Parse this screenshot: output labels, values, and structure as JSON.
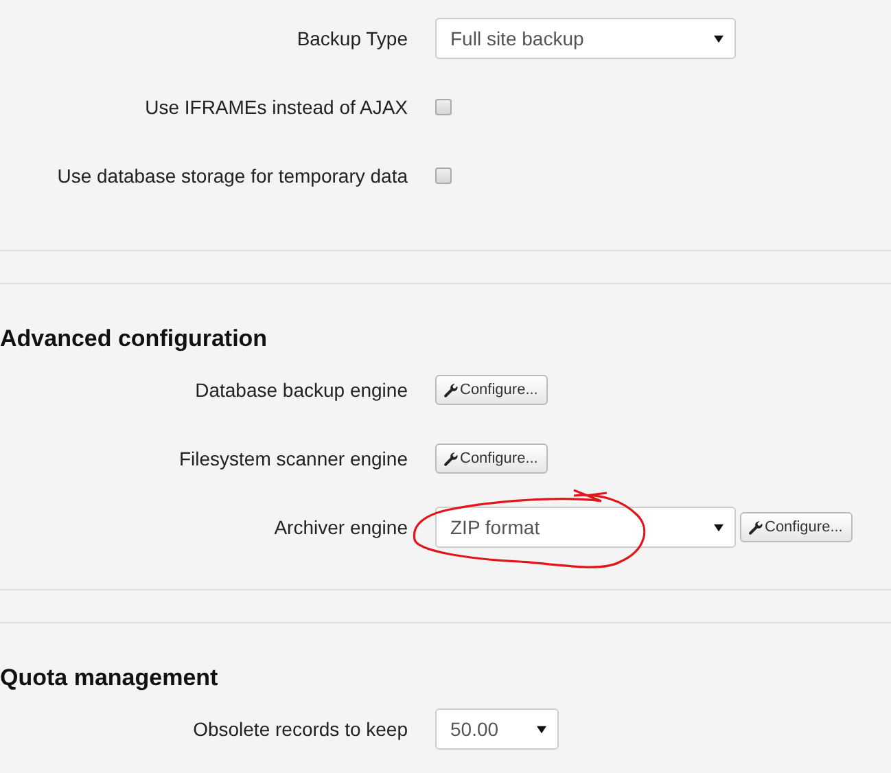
{
  "sections": [
    {
      "rows": [
        {
          "kind": "select",
          "label": "Backup Type",
          "value": "Full site backup"
        },
        {
          "kind": "checkbox",
          "label": "Use IFRAMEs instead of AJAX",
          "checked": false
        },
        {
          "kind": "checkbox",
          "label": "Use database storage for temporary data",
          "checked": false
        }
      ]
    },
    {
      "heading": "Advanced configuration",
      "rows": [
        {
          "kind": "button",
          "label": "Database backup engine",
          "button": "Configure..."
        },
        {
          "kind": "button",
          "label": "Filesystem scanner engine",
          "button": "Configure..."
        },
        {
          "kind": "select_button",
          "label": "Archiver engine",
          "value": "ZIP format",
          "button": "Configure...",
          "circled": true
        }
      ]
    },
    {
      "heading": "Quota management",
      "rows": [
        {
          "kind": "small_select",
          "label": "Obsolete records to keep",
          "value": "50.00"
        }
      ]
    }
  ]
}
